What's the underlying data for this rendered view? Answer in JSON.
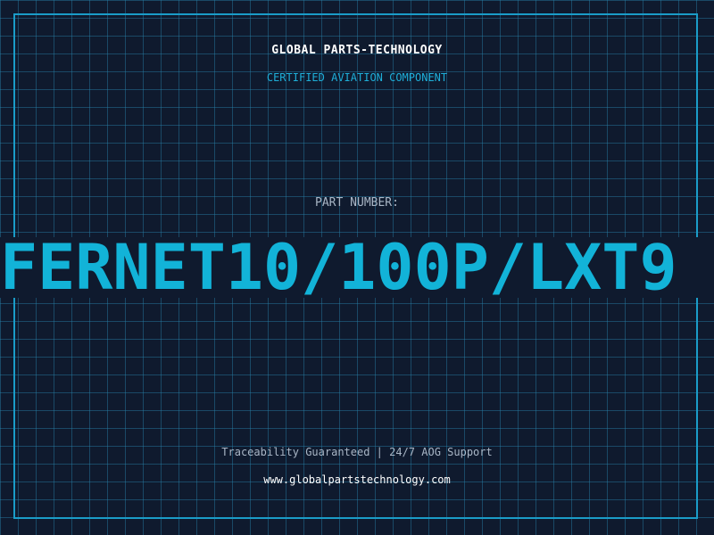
{
  "header": {
    "company": "GLOBAL PARTS-TECHNOLOGY",
    "subtitle": "CERTIFIED AVIATION COMPONENT"
  },
  "part": {
    "label": "PART NUMBER:",
    "number": "FERNET10/100P/LXT9"
  },
  "footer": {
    "tagline": "Traceability Guaranteed | 24/7 AOG Support",
    "website": "www.globalpartstechnology.com"
  },
  "colors": {
    "background": "#0f1a2e",
    "accent": "#12b3d8",
    "grid": "#2882aa"
  }
}
